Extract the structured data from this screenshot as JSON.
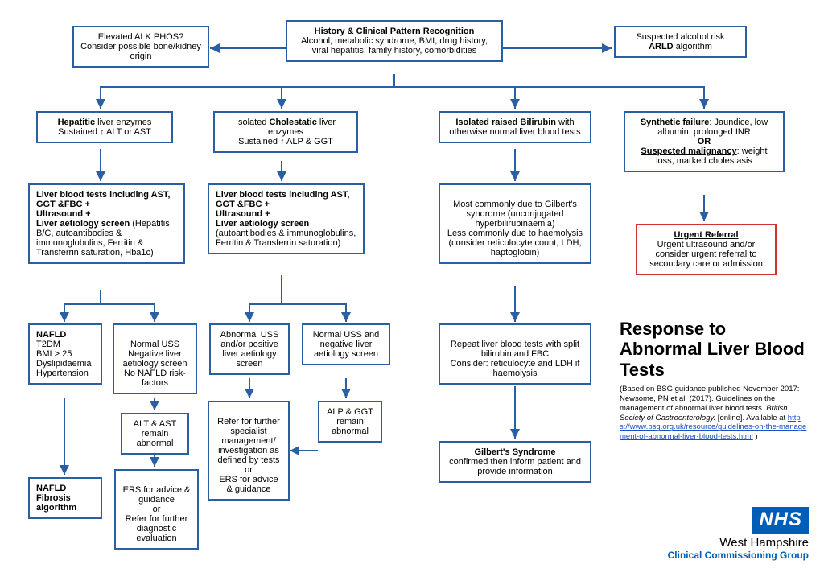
{
  "top": {
    "alk": {
      "line1": "Elevated ALK PHOS?",
      "line2": "Consider possible bone/kidney origin"
    },
    "history": {
      "title": "History & Clinical Pattern Recognition",
      "body": "Alcohol, metabolic syndrome, BMI, drug history, viral hepatitis, family history, comorbidities"
    },
    "arld": {
      "line1": "Suspected alcohol risk",
      "line2": "ARLD",
      "line3": "algorithm"
    }
  },
  "row2": {
    "hep": {
      "t1": "Hepatitic",
      "t2": " liver enzymes",
      "body": "Sustained ↑ ALT or AST"
    },
    "chol": {
      "t1": "Isolated ",
      "t2": "Cholestatic",
      "t3": " liver enzymes",
      "body": "Sustained ↑ ALP & GGT"
    },
    "bili": {
      "t1": "Isolated raised Bilirubin",
      "t2": " with otherwise normal liver blood tests"
    },
    "synth": {
      "l1a": "Synthetic failure",
      "l1b": ": Jaundice, low albumin, prolonged INR",
      "or": "OR",
      "l2a": "Suspected malignancy",
      "l2b": ": weight loss, marked cholestasis"
    }
  },
  "row3": {
    "hep": {
      "l1": "Liver blood tests including AST, GGT &FBC +",
      "l2": "Ultrasound +",
      "l3a": "Liver aetiology screen",
      "l3b": " (Hepatitis B/C, autoantibodies & immunoglobulins, Ferritin & Transferrin saturation, Hba1c)"
    },
    "chol": {
      "l1": "Liver blood tests including AST, GGT &FBC +",
      "l2": "Ultrasound +",
      "l3a": "Liver aetiology screen",
      "l3b": "(autoantibodies & immunoglobulins, Ferritin & Transferrin saturation)"
    },
    "bili": "Most commonly due to Gilbert's syndrome (unconjugated hyperbilirubinaemia)\nLess commonly due to haemolysis (consider reticulocyte count, LDH, haptoglobin)",
    "urgent": {
      "t": "Urgent Referral",
      "b": "Urgent ultrasound and/or consider urgent referral to secondary care or admission"
    }
  },
  "row4": {
    "nafld": {
      "t": "NAFLD",
      "b": "T2DM\nBMI > 25\nDyslipidaemia\nHypertension"
    },
    "normuss_hep": "Normal USS\nNegative liver aetiology screen No NAFLD risk-factors",
    "abn": "Abnormal USS and/or positive liver aetiology screen",
    "normuss_chol": "Normal USS and negative liver aetiology screen",
    "bili2": "Repeat liver blood tests with split bilirubin and FBC\nConsider: reticulocyte and LDH if haemolysis"
  },
  "row5": {
    "altast": "ALT & AST remain abnormal",
    "refer": "Refer for further specialist management/ investigation as defined by tests\nor\nERS for advice & guidance",
    "alpggt": "ALP & GGT remain abnormal",
    "gilbert": {
      "t": "Gilbert's Syndrome",
      "b": "confirmed then inform patient and provide information"
    }
  },
  "row6": {
    "nafld_alg": {
      "t": "NAFLD",
      "b": "Fibrosis algorithm"
    },
    "ers": "ERS for advice & guidance\nor\nRefer for further diagnostic evaluation"
  },
  "info": {
    "title": "Response to Abnormal Liver Blood Tests",
    "src1": "(Based on BSG guidance published November 2017:",
    "src2": "Newsome, PN et al. (2017). Guidelines on the management of abnormal liver blood tests. ",
    "src2i": "British Society of Gastroenterology.",
    "src3": " [online]. Available at ",
    "link": "https://www.bsg.org.uk/resource/guidelines-on-the-management-of-abnormal-liver-blood-tests.html",
    "src4": " )"
  },
  "logo": {
    "nhs": "NHS",
    "line1": "West Hampshire",
    "line2": "Clinical Commissioning Group"
  }
}
